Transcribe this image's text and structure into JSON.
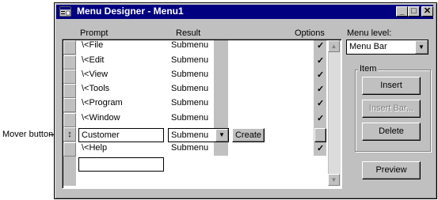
{
  "window": {
    "title": "Menu Designer - Menu1"
  },
  "caption_buttons": {
    "minimize": "_",
    "maximize": "□",
    "close": "✕"
  },
  "columns": {
    "prompt": "Prompt",
    "result": "Result",
    "options": "Options"
  },
  "rows": [
    {
      "prompt": "\\<File",
      "result": "Submenu",
      "check": "✓"
    },
    {
      "prompt": "\\<Edit",
      "result": "Submenu",
      "check": "✓"
    },
    {
      "prompt": "\\<View",
      "result": "Submenu",
      "check": "✓"
    },
    {
      "prompt": "\\<Tools",
      "result": "Submenu",
      "check": "✓"
    },
    {
      "prompt": "\\<Program",
      "result": "Submenu",
      "check": "✓"
    },
    {
      "prompt": "\\<Window",
      "result": "Submenu",
      "check": "✓"
    }
  ],
  "edit_row": {
    "prompt_value": "Customer",
    "result_value": "Submenu",
    "create_label": "Create",
    "mover_glyph": "↕"
  },
  "help_row": {
    "prompt": "\\<Help",
    "result": "Submenu",
    "check": "✓"
  },
  "menu_level": {
    "label": "Menu level:",
    "value": "Menu Bar"
  },
  "item_group": {
    "label": "Item",
    "insert": "Insert",
    "insert_bar": "Insert Bar...",
    "delete": "Delete"
  },
  "preview": {
    "label": "Preview"
  },
  "annotation": {
    "label": "Mover button"
  },
  "icons": {
    "dropdown": "▼",
    "scroll_up": "▲",
    "scroll_down": "▼"
  }
}
